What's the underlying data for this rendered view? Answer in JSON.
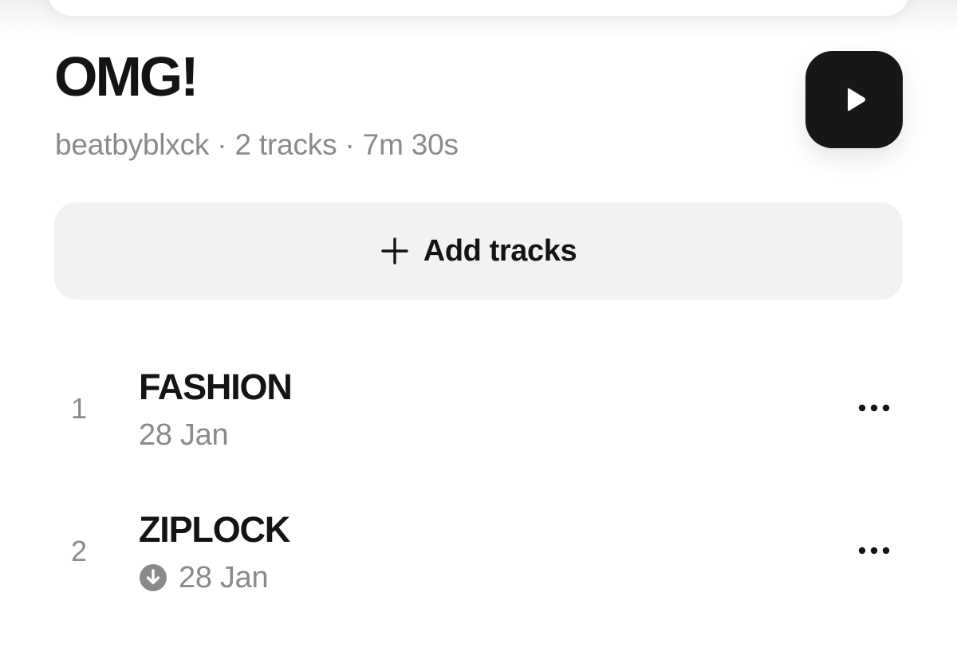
{
  "playlist": {
    "title": "OMG!",
    "meta": "beatbyblxck · 2 tracks · 7m 30s"
  },
  "controls": {
    "play_icon": "play-icon",
    "add_tracks_icon": "plus-icon",
    "add_tracks_label": "Add tracks"
  },
  "tracks": [
    {
      "number": "1",
      "title": "FASHION",
      "date": "28 Jan",
      "downloaded": false,
      "more_icon": "more-icon"
    },
    {
      "number": "2",
      "title": "ZIPLOCK",
      "date": "28 Jan",
      "downloaded": true,
      "status_icon": "download-icon",
      "more_icon": "more-icon"
    }
  ],
  "colors": {
    "background": "#ffffff",
    "primary_text": "#141414",
    "secondary_text": "#8a8a8a",
    "play_button": "#171717",
    "add_tracks_background": "#f2f2f2"
  }
}
